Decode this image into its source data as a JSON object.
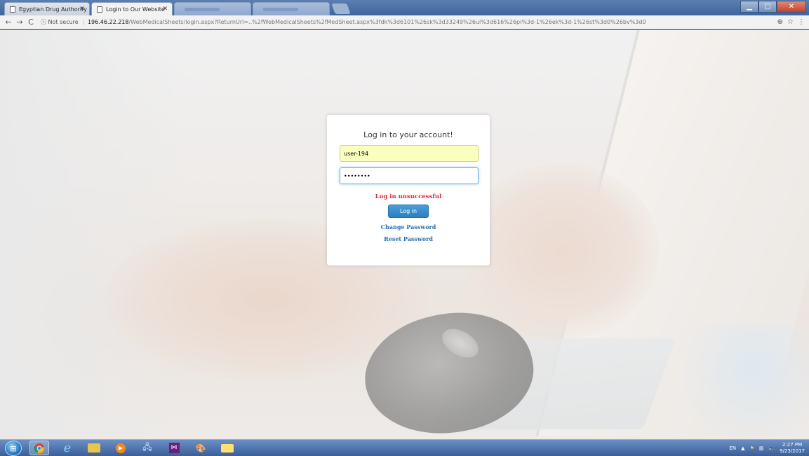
{
  "browser": {
    "tabs": [
      {
        "title": "Egyptian Drug Authority",
        "active": false
      },
      {
        "title": "Login to Our Website",
        "active": true
      }
    ],
    "blurred_tab_count": 3,
    "address": {
      "security_label": "Not secure",
      "host": "196.46.22.218",
      "path": "/WebMedicalSheets/login.aspx?ReturnUrl=..%2fWebMedicalSheets%2fMedSheet.aspx%3fdk%3d6101%26sk%3d33249%26ui%3d616%26pi%3d-1%26ek%3d-1%26st%3d0%26bv%3d0"
    },
    "icons": {
      "back": "back-arrow-icon",
      "forward": "forward-arrow-icon",
      "reload": "reload-icon",
      "info": "info-icon",
      "zoom": "zoom-icon",
      "star": "bookmark-star-icon",
      "menu": "menu-icon"
    }
  },
  "login": {
    "title": "Log in to your account!",
    "username_value": "user-194",
    "password_value": "••••••••",
    "error_message": "Log in unsuccessful",
    "login_button": "Log in",
    "change_password_link": "Change Password",
    "reset_password_link": "Reset Password"
  },
  "taskbar": {
    "apps": [
      "chrome",
      "internet-explorer",
      "file-explorer",
      "media-player",
      "network",
      "visual-studio",
      "paint",
      "folder"
    ],
    "language": "EN",
    "time": "2:27 PM",
    "date": "9/23/2017"
  },
  "colors": {
    "error": "#e0283a",
    "link": "#2a6fb0",
    "button": "#2a7fbf",
    "autofill": "#faffbd"
  }
}
